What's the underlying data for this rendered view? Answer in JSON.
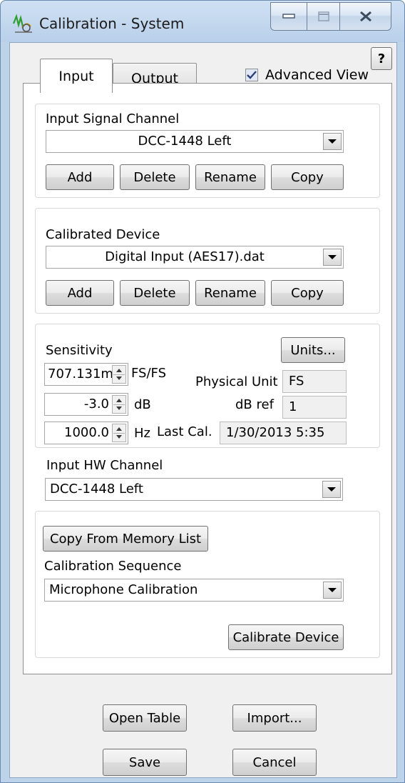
{
  "window": {
    "title": "Calibration  - System"
  },
  "tabs": [
    {
      "label": "Input",
      "active": true
    },
    {
      "label": "Output",
      "active": false
    }
  ],
  "advanced_view": {
    "label": "Advanced View",
    "checked": true
  },
  "help_label": "?",
  "input_signal_channel": {
    "label": "Input Signal Channel",
    "value": "DCC-1448 Left",
    "buttons": {
      "add": "Add",
      "delete": "Delete",
      "rename": "Rename",
      "copy": "Copy"
    }
  },
  "calibrated_device": {
    "label": "Calibrated Device",
    "value": "Digital Input (AES17).dat",
    "buttons": {
      "add": "Add",
      "delete": "Delete",
      "rename": "Rename",
      "copy": "Copy"
    }
  },
  "sensitivity": {
    "label": "Sensitivity",
    "units_button": "Units...",
    "value": "707.131m",
    "unit": "FS/FS",
    "db_value": "-3.0",
    "db_unit": "dB",
    "freq_value": "1000.0",
    "freq_unit": "Hz",
    "physical_unit_label": "Physical Unit",
    "physical_unit_value": "FS",
    "db_ref_label": "dB ref",
    "db_ref_value": "1",
    "last_cal_label": "Last Cal.",
    "last_cal_value": "1/30/2013 5:35"
  },
  "input_hw_channel": {
    "label": "Input HW Channel",
    "value": "DCC-1448 Left"
  },
  "memory": {
    "copy_button": "Copy From Memory List",
    "sequence_label": "Calibration Sequence",
    "sequence_value": "Microphone Calibration",
    "calibrate_button": "Calibrate Device"
  },
  "footer": {
    "open_table": "Open Table",
    "import": "Import...",
    "save": "Save",
    "cancel": "Cancel"
  },
  "colors": {
    "frame": "#bcd3ea",
    "dialog_bg": "#f0f0f0",
    "close_glyph": "#3c4a5c"
  }
}
